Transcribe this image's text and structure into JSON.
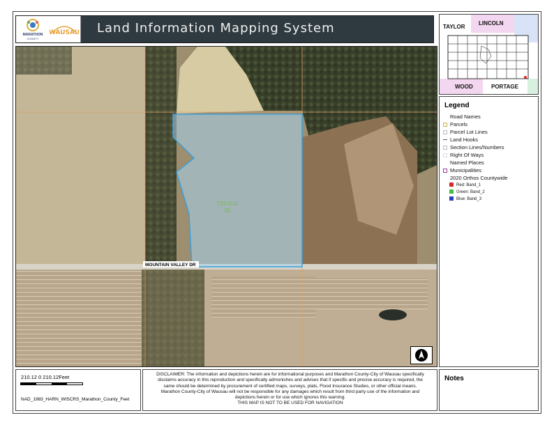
{
  "header": {
    "title": "Land Information Mapping System",
    "logo_county_top": "MARATHON",
    "logo_county_bottom": "COUNTY",
    "logo_wausau": "WAUSAU"
  },
  "map": {
    "parcel_label_line1": "T26 R10",
    "parcel_label_line2": "35",
    "road_label": "MOUNTAIN VALLEY DR",
    "north_arrow": "north-arrow-icon"
  },
  "inset": {
    "counties": [
      "TAYLOR",
      "LINCOLN",
      "WOOD",
      "PORTAGE"
    ]
  },
  "legend": {
    "title": "Legend",
    "items": [
      {
        "label": "Road Names",
        "symbol": "none"
      },
      {
        "label": "Parcels",
        "symbol": "box-yellow"
      },
      {
        "label": "Parcel Lot Lines",
        "symbol": "box-gray"
      },
      {
        "label": "Land Hooks",
        "symbol": "line"
      },
      {
        "label": "Section Lines/Numbers",
        "symbol": "box-gray"
      },
      {
        "label": "Right Of Ways",
        "symbol": "box-light"
      },
      {
        "label": "Named Places",
        "symbol": "none"
      },
      {
        "label": "Municipalities",
        "symbol": "box-purple"
      },
      {
        "label": "2020 Orthos Countywide",
        "symbol": "none"
      }
    ],
    "bands": [
      {
        "label": "Red:   Band_1",
        "color": "#d62828"
      },
      {
        "label": "Green: Band_2",
        "color": "#3fbf3f"
      },
      {
        "label": "Blue:  Band_3",
        "color": "#2a3fbf"
      }
    ]
  },
  "scale": {
    "text": "210.12    0    210.12Feet",
    "projection": "NAD_1983_HARN_WISCRS_Marathon_County_Feet"
  },
  "disclaimer": {
    "line1": "DISCLAIMER: The information and depictions herein are for informational purposes and Marathon County-City of Wausau specifically",
    "line2": "disclaims accuracy in this reproduction and specifically admonishes and advises that if specific and precise accuracy is required, the",
    "line3": "same should be determined by procurement of certified maps, surveys, plats, Flood Insurance Studies, or other official means.",
    "line4": "Marathon County-City of Wausau will not be responsible for any damages which result from third party use of the information and",
    "line5": "depictions herein or for use which ignores this warning.",
    "line6": "THIS MAP IS NOT TO BE USED FOR NAVIGATION"
  },
  "notes": {
    "title": "Notes"
  }
}
